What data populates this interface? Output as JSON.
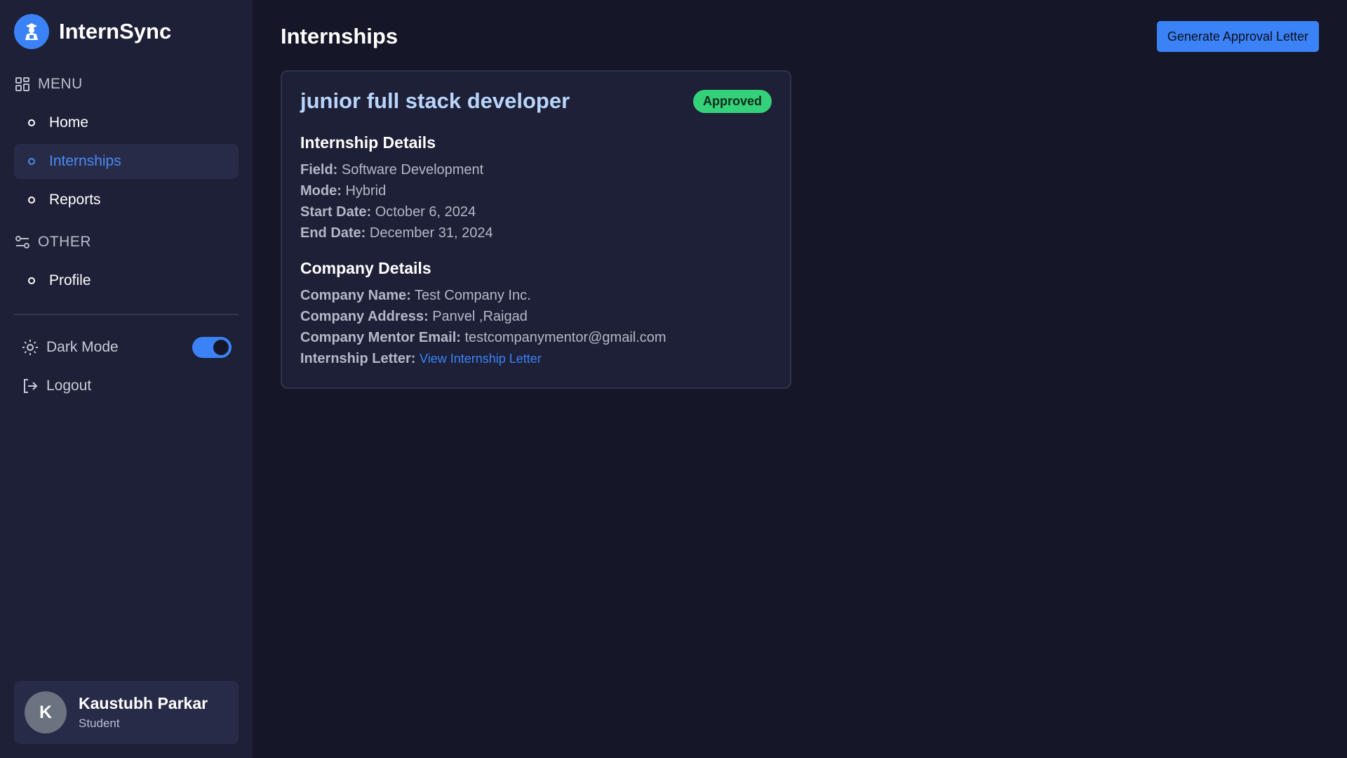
{
  "brand": {
    "name": "InternSync"
  },
  "sidebar": {
    "menu_heading": "MENU",
    "menu_items": [
      {
        "label": "Home"
      },
      {
        "label": "Internships"
      },
      {
        "label": "Reports"
      }
    ],
    "other_heading": "OTHER",
    "other_items": [
      {
        "label": "Profile"
      }
    ],
    "dark_mode_label": "Dark Mode",
    "dark_mode_on": true,
    "logout_label": "Logout"
  },
  "user": {
    "initial": "K",
    "name": "Kaustubh Parkar",
    "role": "Student"
  },
  "header": {
    "title": "Internships",
    "action_label": "Generate Approval Letter"
  },
  "internship": {
    "title": "junior full stack developer",
    "status": "Approved",
    "details_heading": "Internship Details",
    "field_label": "Field:",
    "field": "Software Development",
    "mode_label": "Mode:",
    "mode": "Hybrid",
    "start_label": "Start Date:",
    "start_date": "October 6, 2024",
    "end_label": "End Date:",
    "end_date": "December 31, 2024",
    "company_heading": "Company Details",
    "company_name_label": "Company Name:",
    "company_name": "Test Company Inc.",
    "company_address_label": "Company Address:",
    "company_address": "Panvel ,Raigad",
    "mentor_email_label": "Company Mentor Email:",
    "mentor_email": "testcompanymentor@gmail.com",
    "letter_label": "Internship Letter:",
    "letter_link": "View Internship Letter"
  },
  "colors": {
    "accent": "#3b82f6",
    "status_approved": "#34d17a",
    "background": "#151728",
    "sidebar": "#1d2036"
  }
}
